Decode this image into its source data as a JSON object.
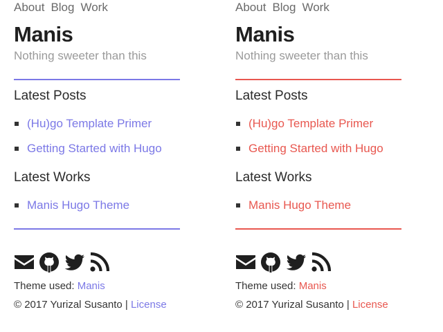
{
  "panels": [
    {
      "accent": "#7b78e6",
      "nav": {
        "about": "About",
        "blog": "Blog",
        "work": "Work"
      },
      "title": "Manis",
      "tagline": "Nothing sweeter than this",
      "latest_posts_heading": "Latest Posts",
      "posts": [
        "(Hu)go Template Primer",
        "Getting Started with Hugo"
      ],
      "latest_works_heading": "Latest Works",
      "works": [
        "Manis Hugo Theme"
      ],
      "social_icons": [
        "email-icon",
        "github-icon",
        "twitter-icon",
        "rss-icon"
      ],
      "footer": {
        "theme_prefix": "Theme used: ",
        "theme_link": "Manis",
        "copyright": "© 2017 Yurizal Susanto | ",
        "license_link": "License"
      }
    },
    {
      "accent": "#e8574f",
      "nav": {
        "about": "About",
        "blog": "Blog",
        "work": "Work"
      },
      "title": "Manis",
      "tagline": "Nothing sweeter than this",
      "latest_posts_heading": "Latest Posts",
      "posts": [
        "(Hu)go Template Primer",
        "Getting Started with Hugo"
      ],
      "latest_works_heading": "Latest Works",
      "works": [
        "Manis Hugo Theme"
      ],
      "social_icons": [
        "email-icon",
        "github-icon",
        "twitter-icon",
        "rss-icon"
      ],
      "footer": {
        "theme_prefix": "Theme used: ",
        "theme_link": "Manis",
        "copyright": "© 2017 Yurizal Susanto | ",
        "license_link": "License"
      }
    }
  ]
}
